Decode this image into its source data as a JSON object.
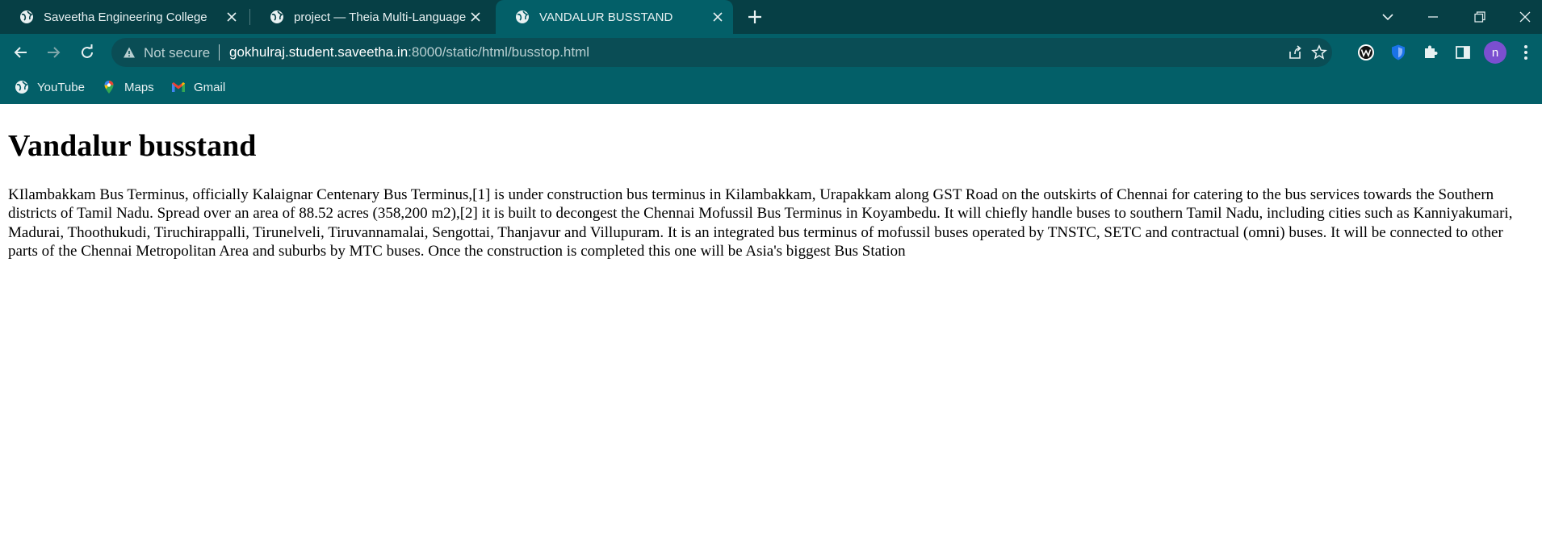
{
  "browser": {
    "tabs": [
      {
        "title": "Saveetha Engineering College",
        "active": false
      },
      {
        "title": "project — Theia Multi-Language",
        "active": false
      },
      {
        "title": "VANDALUR BUSSTAND",
        "active": true
      }
    ],
    "omnibox": {
      "security_label": "Not secure",
      "url_host": "gokhulraj.student.saveetha.in",
      "url_path": ":8000/static/html/busstop.html"
    },
    "bookmarks": [
      {
        "label": "YouTube",
        "icon": "globe-icon"
      },
      {
        "label": "Maps",
        "icon": "maps-icon"
      },
      {
        "label": "Gmail",
        "icon": "gmail-icon"
      }
    ],
    "profile_initial": "n",
    "colors": {
      "tabstrip": "#063f45",
      "toolbar": "#035f68",
      "omnibox": "#0a4d55",
      "avatar": "#7b4fd0"
    }
  },
  "page": {
    "heading": "Vandalur busstand",
    "paragraph": "KIlambakkam Bus Terminus, officially Kalaignar Centenary Bus Terminus,[1] is under construction bus terminus in Kilambakkam, Urapakkam along GST Road on the outskirts of Chennai for catering to the bus services towards the Southern districts of Tamil Nadu. Spread over an area of 88.52 acres (358,200 m2),[2] it is built to decongest the Chennai Mofussil Bus Terminus in Koyambedu. It will chiefly handle buses to southern Tamil Nadu, including cities such as Kanniyakumari, Madurai, Thoothukudi, Tiruchirappalli, Tirunelveli, Tiruvannamalai, Sengottai, Thanjavur and Villupuram. It is an integrated bus terminus of mofussil buses operated by TNSTC, SETC and contractual (omni) buses. It will be connected to other parts of the Chennai Metropolitan Area and suburbs by MTC buses. Once the construction is completed this one will be Asia's biggest Bus Station"
  }
}
